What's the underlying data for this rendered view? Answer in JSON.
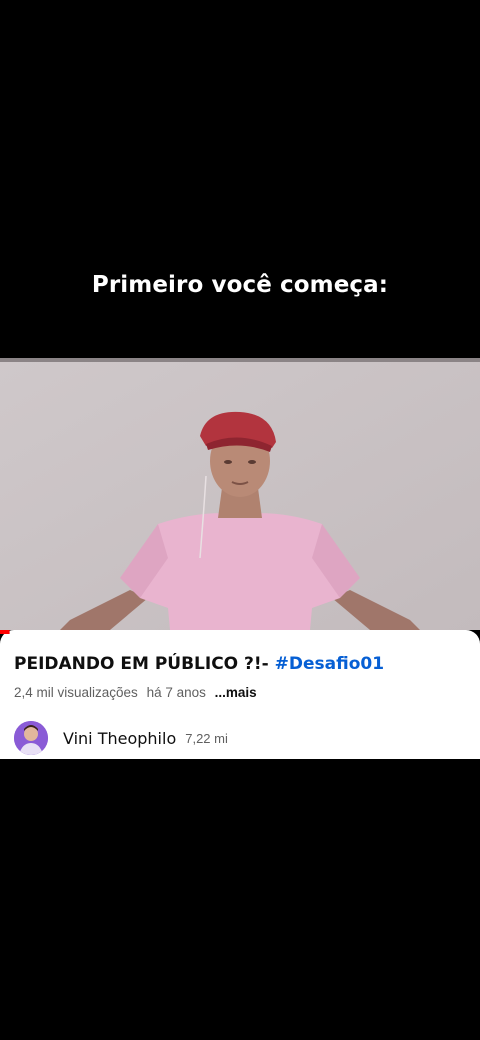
{
  "overlay": {
    "caption": "Primeiro você começa:"
  },
  "video": {
    "title_main": "PEIDANDO EM PÚBLICO ?!- ",
    "title_hashtag": "#Desafio01",
    "views": "2,4 mil visualizações",
    "age": "há 7 anos",
    "more_label": "...mais",
    "progress": 0.02
  },
  "channel": {
    "name": "Vini Theophilo",
    "subscribers": "7,22 mi",
    "avatar_icon": "channel-avatar"
  },
  "colors": {
    "background": "#000000",
    "card": "#ffffff",
    "hashtag": "#065fd4",
    "progress": "#ff0000",
    "secondary_text": "#606060"
  }
}
